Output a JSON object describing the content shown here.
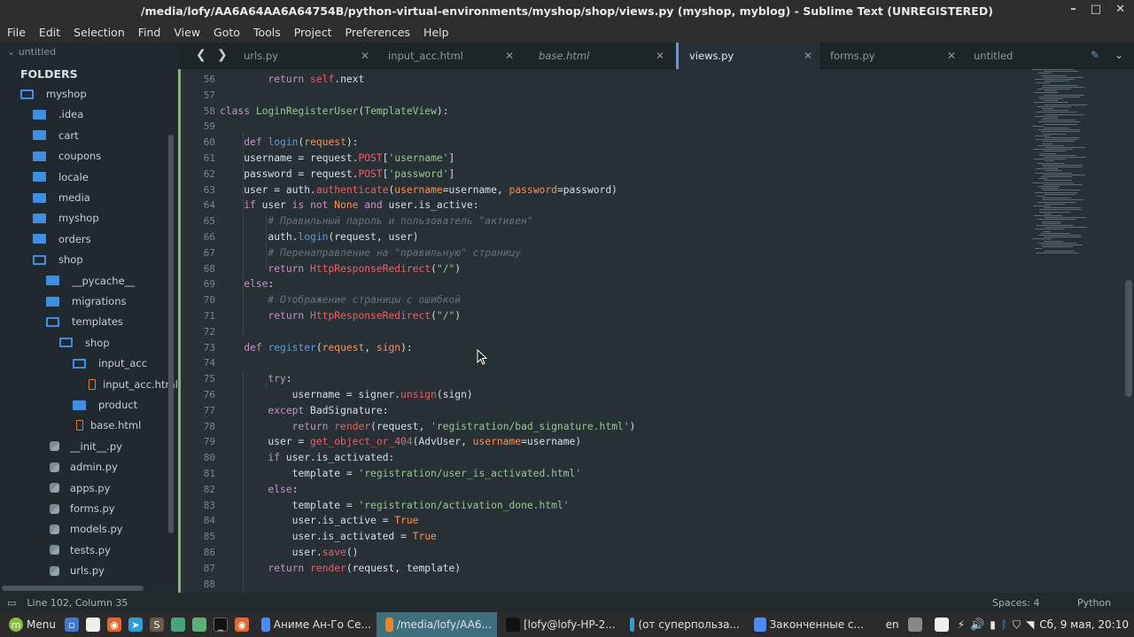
{
  "window": {
    "title": "/media/lofy/AA6A64AA6A64754B/python-virtual-environments/myshop/shop/views.py (myshop, myblog) - Sublime Text (UNREGISTERED)",
    "minimize": "–",
    "maximize": "□",
    "close": "✕"
  },
  "menu": [
    "File",
    "Edit",
    "Selection",
    "Find",
    "View",
    "Goto",
    "Tools",
    "Project",
    "Preferences",
    "Help"
  ],
  "sidebar": {
    "open_file": "untitled",
    "folders_title": "FOLDERS",
    "tree": [
      {
        "label": "myshop",
        "type": "folder-open"
      },
      {
        "label": ".idea",
        "type": "folder"
      },
      {
        "label": "cart",
        "type": "folder"
      },
      {
        "label": "coupons",
        "type": "folder"
      },
      {
        "label": "locale",
        "type": "folder"
      },
      {
        "label": "media",
        "type": "folder"
      },
      {
        "label": "myshop",
        "type": "folder"
      },
      {
        "label": "orders",
        "type": "folder"
      },
      {
        "label": "shop",
        "type": "folder-open"
      },
      {
        "label": "__pycache__",
        "type": "folder"
      },
      {
        "label": "migrations",
        "type": "folder"
      },
      {
        "label": "templates",
        "type": "folder-open"
      },
      {
        "label": "shop",
        "type": "folder-open"
      },
      {
        "label": "input_acc",
        "type": "folder-open"
      },
      {
        "label": "input_acc.html",
        "type": "html"
      },
      {
        "label": "product",
        "type": "folder"
      },
      {
        "label": "base.html",
        "type": "html"
      },
      {
        "label": "__init__.py",
        "type": "py"
      },
      {
        "label": "admin.py",
        "type": "py"
      },
      {
        "label": "apps.py",
        "type": "py"
      },
      {
        "label": "forms.py",
        "type": "py"
      },
      {
        "label": "models.py",
        "type": "py"
      },
      {
        "label": "tests.py",
        "type": "py"
      },
      {
        "label": "urls.py",
        "type": "py"
      }
    ]
  },
  "tabs": [
    {
      "label": "urls.py",
      "active": false,
      "italic": false
    },
    {
      "label": "input_acc.html",
      "active": false,
      "italic": false
    },
    {
      "label": "base.html",
      "active": false,
      "italic": true
    },
    {
      "label": "views.py",
      "active": true,
      "italic": false
    },
    {
      "label": "forms.py",
      "active": false,
      "italic": false
    },
    {
      "label": "untitled",
      "active": false,
      "italic": false
    }
  ],
  "editor": {
    "lines": [
      {
        "n": "56",
        "html": "        <span class='kw'>return</span> <span class='self'>self</span>.next"
      },
      {
        "n": "57",
        "html": ""
      },
      {
        "n": "58",
        "html": "<span class='kw'>class</span> <span class='cls'>LoginRegisterUser</span>(<span class='cls'>TemplateView</span>):"
      },
      {
        "n": "59",
        "html": ""
      },
      {
        "n": "60",
        "html": "    <span class='kw'>def</span> <span class='fn'>login</span>(<span class='prm'>request</span>):"
      },
      {
        "n": "61",
        "html": "    username = request.<span class='ty'>POST</span>[<span class='str'>'username'</span>]"
      },
      {
        "n": "62",
        "html": "    password = request.<span class='ty'>POST</span>[<span class='str'>'password'</span>]"
      },
      {
        "n": "63",
        "html": "    user = auth.<span class='ty'>authenticate</span>(<span class='prm'>username</span>=username, <span class='prm'>password</span>=password)"
      },
      {
        "n": "64",
        "html": "    <span class='kw'>if</span> user <span class='kw'>is</span> <span class='kw'>not</span> <span class='cons'>None</span> <span class='kw'>and</span> user.is_active:"
      },
      {
        "n": "65",
        "html": "        <span class='cm'># Правильный пароль и пользователь \"активен\"</span>"
      },
      {
        "n": "66",
        "html": "        auth.<span class='fn'>login</span>(request, user)"
      },
      {
        "n": "67",
        "html": "        <span class='cm'># Перенаправление на \"правильную\" страницу</span>"
      },
      {
        "n": "68",
        "html": "        <span class='kw'>return</span> <span class='ty'>HttpResponseRedirect</span>(<span class='str'>\"/\"</span>)"
      },
      {
        "n": "69",
        "html": "    <span class='kw'>else</span>:"
      },
      {
        "n": "70",
        "html": "        <span class='cm'># Отображение страницы с ошибкой</span>"
      },
      {
        "n": "71",
        "html": "        <span class='kw'>return</span> <span class='ty'>HttpResponseRedirect</span>(<span class='str'>\"/\"</span>)"
      },
      {
        "n": "72",
        "html": ""
      },
      {
        "n": "73",
        "html": "    <span class='kw'>def</span> <span class='fn'>register</span>(<span class='prm'>request</span>, <span class='prm'>sign</span>):"
      },
      {
        "n": "74",
        "html": ""
      },
      {
        "n": "75",
        "html": "        <span class='kw'>try</span>:"
      },
      {
        "n": "76",
        "html": "            username = signer.<span class='ty'>unsign</span>(sign)"
      },
      {
        "n": "77",
        "html": "        <span class='kw'>except</span> BadSignature:"
      },
      {
        "n": "78",
        "html": "            <span class='kw'>return</span> <span class='ty'>render</span>(request, <span class='str'>'registration/bad_signature.html'</span>)"
      },
      {
        "n": "79",
        "html": "        user = <span class='ty'>get_object_or_404</span>(AdvUser, <span class='prm'>username</span>=username)"
      },
      {
        "n": "80",
        "html": "        <span class='kw'>if</span> user.is_activated:"
      },
      {
        "n": "81",
        "html": "            template = <span class='str'>'registration/user_is_activated.html'</span>"
      },
      {
        "n": "82",
        "html": "        <span class='kw'>else</span>:"
      },
      {
        "n": "83",
        "html": "            template = <span class='str'>'registration/activation_done.html'</span>"
      },
      {
        "n": "84",
        "html": "            user.is_active = <span class='cons'>True</span>"
      },
      {
        "n": "85",
        "html": "            user.is_activated = <span class='cons'>True</span>"
      },
      {
        "n": "86",
        "html": "            user.<span class='ty'>save</span>()"
      },
      {
        "n": "87",
        "html": "        <span class='kw'>return</span> <span class='ty'>render</span>(request, template)"
      },
      {
        "n": "88",
        "html": ""
      }
    ]
  },
  "status": {
    "position": "Line 102, Column 35",
    "spaces": "Spaces: 4",
    "syntax": "Python"
  },
  "taskbar": {
    "menu_label": "Menu",
    "tasks": [
      {
        "label": "Аниме Ан-Го Се...",
        "icon": "chrome-icon"
      },
      {
        "label": "/media/lofy/AA6...",
        "icon": "sublime-icon"
      },
      {
        "label": "[lofy@lofy-HP-2...",
        "icon": "terminal-icon"
      },
      {
        "label": "(от суперпольза...",
        "icon": "telegram-icon"
      },
      {
        "label": "Законченные с...",
        "icon": "chrome-icon"
      }
    ],
    "lang": "en",
    "clock": "Сб, 9 мая, 20:10"
  }
}
